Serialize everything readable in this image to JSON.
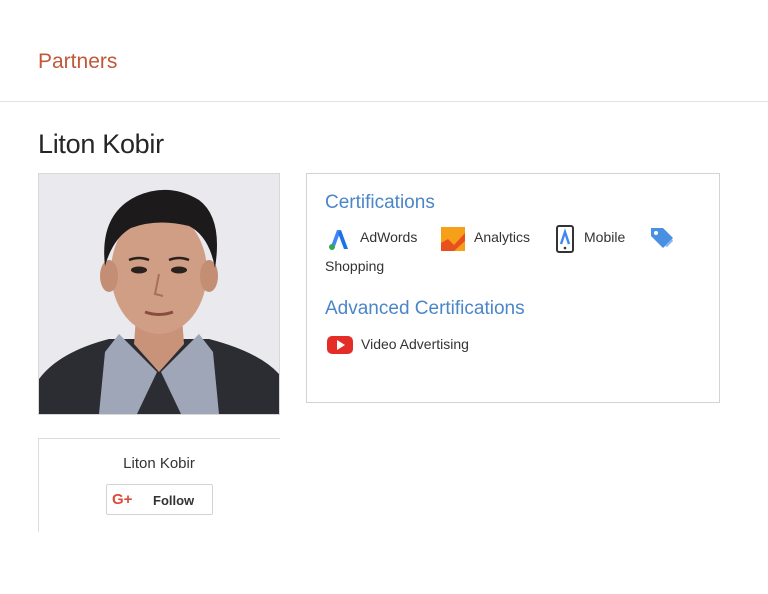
{
  "header": {
    "title": "Partners"
  },
  "profile": {
    "name": "Liton Kobir",
    "photo_alt": "Liton Kobir"
  },
  "gplus_card": {
    "name": "Liton Kobir",
    "follow_button": {
      "logo": "G+",
      "label": "Follow"
    }
  },
  "certifications": {
    "heading": "Certifications",
    "items": [
      {
        "label": "AdWords",
        "icon": "adwords-icon",
        "color": "#4285f4"
      },
      {
        "label": "Analytics",
        "icon": "analytics-icon",
        "color": "#f4821f"
      },
      {
        "label": "Mobile",
        "icon": "mobile-icon",
        "color": "#34a853"
      },
      {
        "label": "Shopping",
        "icon": "shopping-icon",
        "color": "#4a90e2"
      }
    ]
  },
  "advanced_certifications": {
    "heading": "Advanced Certifications",
    "items": [
      {
        "label": "Video Advertising",
        "icon": "youtube-icon",
        "color": "#e52d27"
      }
    ]
  },
  "colors": {
    "header_title": "#c0583a",
    "heading_blue": "#4a86c8",
    "gplus_red": "#dd4b39"
  }
}
